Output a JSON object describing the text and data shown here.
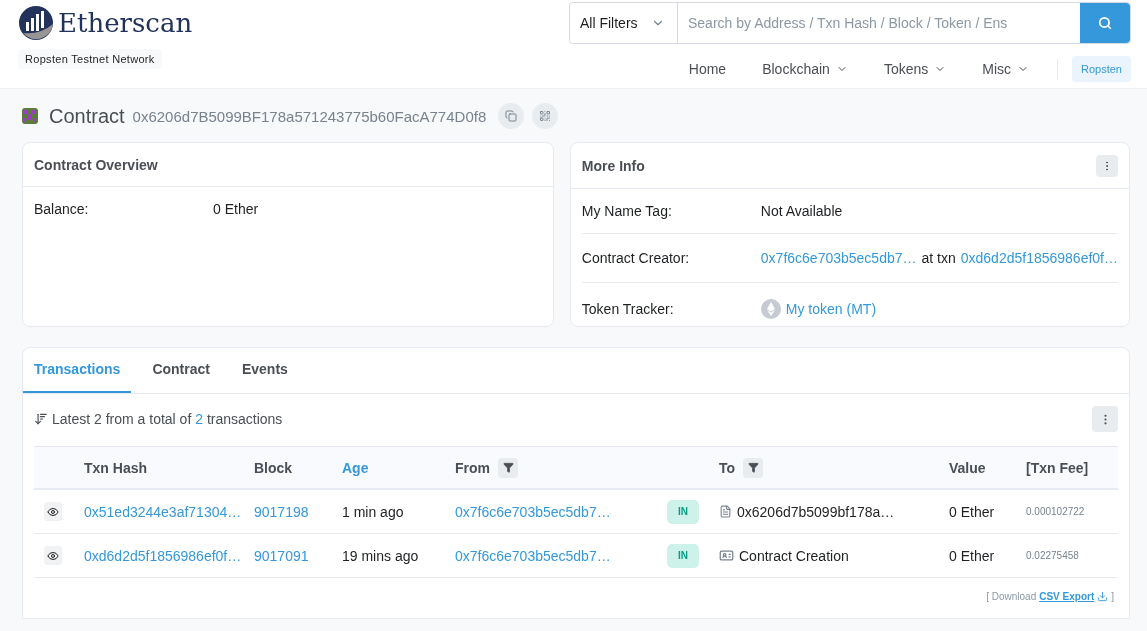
{
  "header": {
    "logo": "Etherscan",
    "network": "Ropsten Testnet Network",
    "filter": "All Filters",
    "search_placeholder": "Search by Address / Txn Hash / Block / Token / Ens",
    "nav": [
      {
        "label": "Home",
        "dropdown": false
      },
      {
        "label": "Blockchain",
        "dropdown": true
      },
      {
        "label": "Tokens",
        "dropdown": true
      },
      {
        "label": "Misc",
        "dropdown": true
      }
    ],
    "network_button": "Ropsten"
  },
  "contract": {
    "label": "Contract",
    "address": "0x6206d7B5099BF178a571243775b60FacA774D0f8"
  },
  "overview": {
    "title": "Contract Overview",
    "rows": [
      {
        "label": "Balance:",
        "value": "0 Ether"
      }
    ]
  },
  "more_info": {
    "title": "More Info",
    "rows": [
      {
        "kind": "text",
        "label": "My Name Tag:",
        "value": "Not Available"
      },
      {
        "kind": "creator",
        "label": "Contract Creator:",
        "address": "0x7f6c6e703b5ec5db7…",
        "connector": "at txn",
        "txn": "0xd6d2d5f1856986ef0f…"
      },
      {
        "kind": "token",
        "label": "Token Tracker:",
        "value": "My token (MT)"
      }
    ]
  },
  "tabs": [
    {
      "label": "Transactions",
      "selected": true
    },
    {
      "label": "Contract",
      "selected": false
    },
    {
      "label": "Events",
      "selected": false
    }
  ],
  "summary": {
    "prefix": "Latest 2 from a total of",
    "count": "2",
    "suffix": "transactions"
  },
  "columns": [
    {
      "label": "Txn Hash",
      "kind": "plain"
    },
    {
      "label": "Block",
      "kind": "plain"
    },
    {
      "label": "Age",
      "kind": "link"
    },
    {
      "label": "From",
      "kind": "filter"
    },
    {
      "label": "To",
      "kind": "filter"
    },
    {
      "label": "Value",
      "kind": "plain"
    },
    {
      "label": "[Txn Fee]",
      "kind": "plain"
    }
  ],
  "rows": [
    {
      "hash": "0x51ed3244e3af71304…",
      "block": "9017198",
      "age": "1 min ago",
      "from": "0x7f6c6e703b5ec5db7…",
      "direction": "IN",
      "kind": "contract",
      "to": "0x6206d7b5099bf178a…",
      "value": "0 Ether",
      "fee": "0.000102722"
    },
    {
      "hash": "0xd6d2d5f1856986ef0f…",
      "block": "9017091",
      "age": "19 mins ago",
      "from": "0x7f6c6e703b5ec5db7…",
      "direction": "IN",
      "kind": "creation",
      "to": "Contract Creation",
      "value": "0 Ether",
      "fee": "0.02275458"
    }
  ],
  "footer": {
    "prefix": "[ Download",
    "link": "CSV Export",
    "suffix": "]"
  }
}
